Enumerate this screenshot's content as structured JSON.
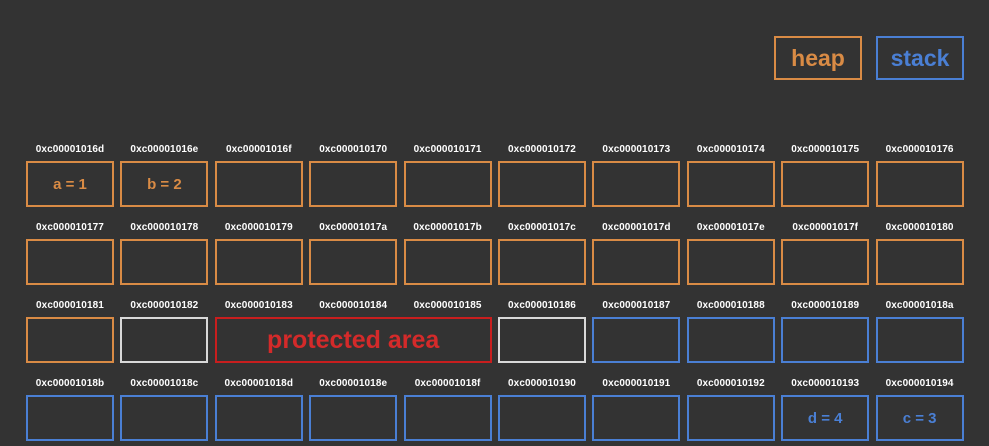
{
  "legend": {
    "heap_label": "heap",
    "stack_label": "stack"
  },
  "rows": [
    {
      "addresses": [
        "0xc00001016d",
        "0xc00001016e",
        "0xc00001016f",
        "0xc000010170",
        "0xc000010171",
        "0xc000010172",
        "0xc000010173",
        "0xc000010174",
        "0xc000010175",
        "0xc000010176"
      ],
      "cells": [
        {
          "type": "heap",
          "label": "a = 1"
        },
        {
          "type": "heap",
          "label": "b = 2"
        },
        {
          "type": "heap",
          "label": ""
        },
        {
          "type": "heap",
          "label": ""
        },
        {
          "type": "heap",
          "label": ""
        },
        {
          "type": "heap",
          "label": ""
        },
        {
          "type": "heap",
          "label": ""
        },
        {
          "type": "heap",
          "label": ""
        },
        {
          "type": "heap",
          "label": ""
        },
        {
          "type": "heap",
          "label": ""
        }
      ]
    },
    {
      "addresses": [
        "0xc000010177",
        "0xc000010178",
        "0xc000010179",
        "0xc00001017a",
        "0xc00001017b",
        "0xc00001017c",
        "0xc00001017d",
        "0xc00001017e",
        "0xc00001017f",
        "0xc000010180"
      ],
      "cells": [
        {
          "type": "heap",
          "label": ""
        },
        {
          "type": "heap",
          "label": ""
        },
        {
          "type": "heap",
          "label": ""
        },
        {
          "type": "heap",
          "label": ""
        },
        {
          "type": "heap",
          "label": ""
        },
        {
          "type": "heap",
          "label": ""
        },
        {
          "type": "heap",
          "label": ""
        },
        {
          "type": "heap",
          "label": ""
        },
        {
          "type": "heap",
          "label": ""
        },
        {
          "type": "heap",
          "label": ""
        }
      ]
    },
    {
      "addresses": [
        "0xc000010181",
        "0xc000010182",
        "0xc000010183",
        "0xc000010184",
        "0xc000010185",
        "0xc000010186",
        "0xc000010187",
        "0xc000010188",
        "0xc000010189",
        "0xc00001018a"
      ],
      "cells": [
        {
          "type": "heap",
          "label": ""
        },
        {
          "type": "guard",
          "label": ""
        },
        {
          "type": "protected",
          "label": "protected area",
          "span": 3
        },
        {
          "type": "guard",
          "label": ""
        },
        {
          "type": "stack",
          "label": ""
        },
        {
          "type": "stack",
          "label": ""
        },
        {
          "type": "stack",
          "label": ""
        },
        {
          "type": "stack",
          "label": ""
        }
      ]
    },
    {
      "addresses": [
        "0xc00001018b",
        "0xc00001018c",
        "0xc00001018d",
        "0xc00001018e",
        "0xc00001018f",
        "0xc000010190",
        "0xc000010191",
        "0xc000010192",
        "0xc000010193",
        "0xc000010194"
      ],
      "cells": [
        {
          "type": "stack",
          "label": ""
        },
        {
          "type": "stack",
          "label": ""
        },
        {
          "type": "stack",
          "label": ""
        },
        {
          "type": "stack",
          "label": ""
        },
        {
          "type": "stack",
          "label": ""
        },
        {
          "type": "stack",
          "label": ""
        },
        {
          "type": "stack",
          "label": ""
        },
        {
          "type": "stack",
          "label": ""
        },
        {
          "type": "stack",
          "label": "d = 4"
        },
        {
          "type": "stack",
          "label": "c = 3"
        }
      ]
    }
  ]
}
